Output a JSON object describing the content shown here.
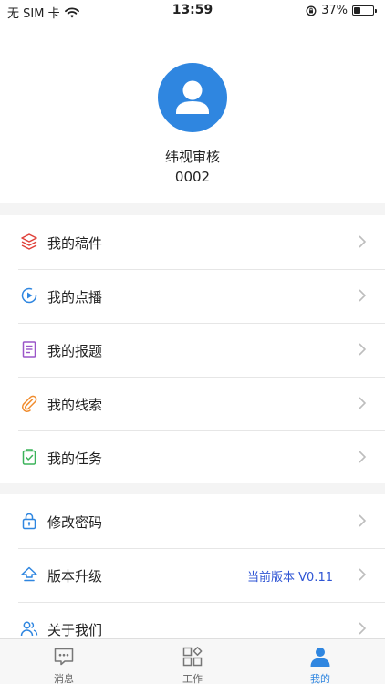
{
  "status_bar": {
    "carrier": "无 SIM 卡",
    "time": "13:59",
    "battery": "37%",
    "battery_level": 0.37
  },
  "profile": {
    "name": "纬视审核",
    "id": "0002"
  },
  "menu_primary": [
    {
      "label": "我的稿件",
      "icon": "layers-icon",
      "color": "#e0413a"
    },
    {
      "label": "我的点播",
      "icon": "play-circle-icon",
      "color": "#2f86e0"
    },
    {
      "label": "我的报题",
      "icon": "document-icon",
      "color": "#9a55c8"
    },
    {
      "label": "我的线索",
      "icon": "paperclip-icon",
      "color": "#f08c2e"
    },
    {
      "label": "我的任务",
      "icon": "clipboard-check-icon",
      "color": "#3bb35a"
    }
  ],
  "menu_secondary": [
    {
      "label": "修改密码",
      "icon": "lock-icon",
      "color": "#2f86e0"
    },
    {
      "label": "版本升级",
      "icon": "upgrade-icon",
      "color": "#2f86e0",
      "value": "当前版本 V0.11"
    },
    {
      "label": "关于我们",
      "icon": "users-icon",
      "color": "#2f86e0"
    }
  ],
  "tabbar": {
    "active_color": "#2f86e0",
    "tabs": [
      {
        "label": "消息",
        "icon": "message-icon"
      },
      {
        "label": "工作",
        "icon": "apps-icon"
      },
      {
        "label": "我的",
        "icon": "person-icon",
        "active": true
      }
    ]
  }
}
